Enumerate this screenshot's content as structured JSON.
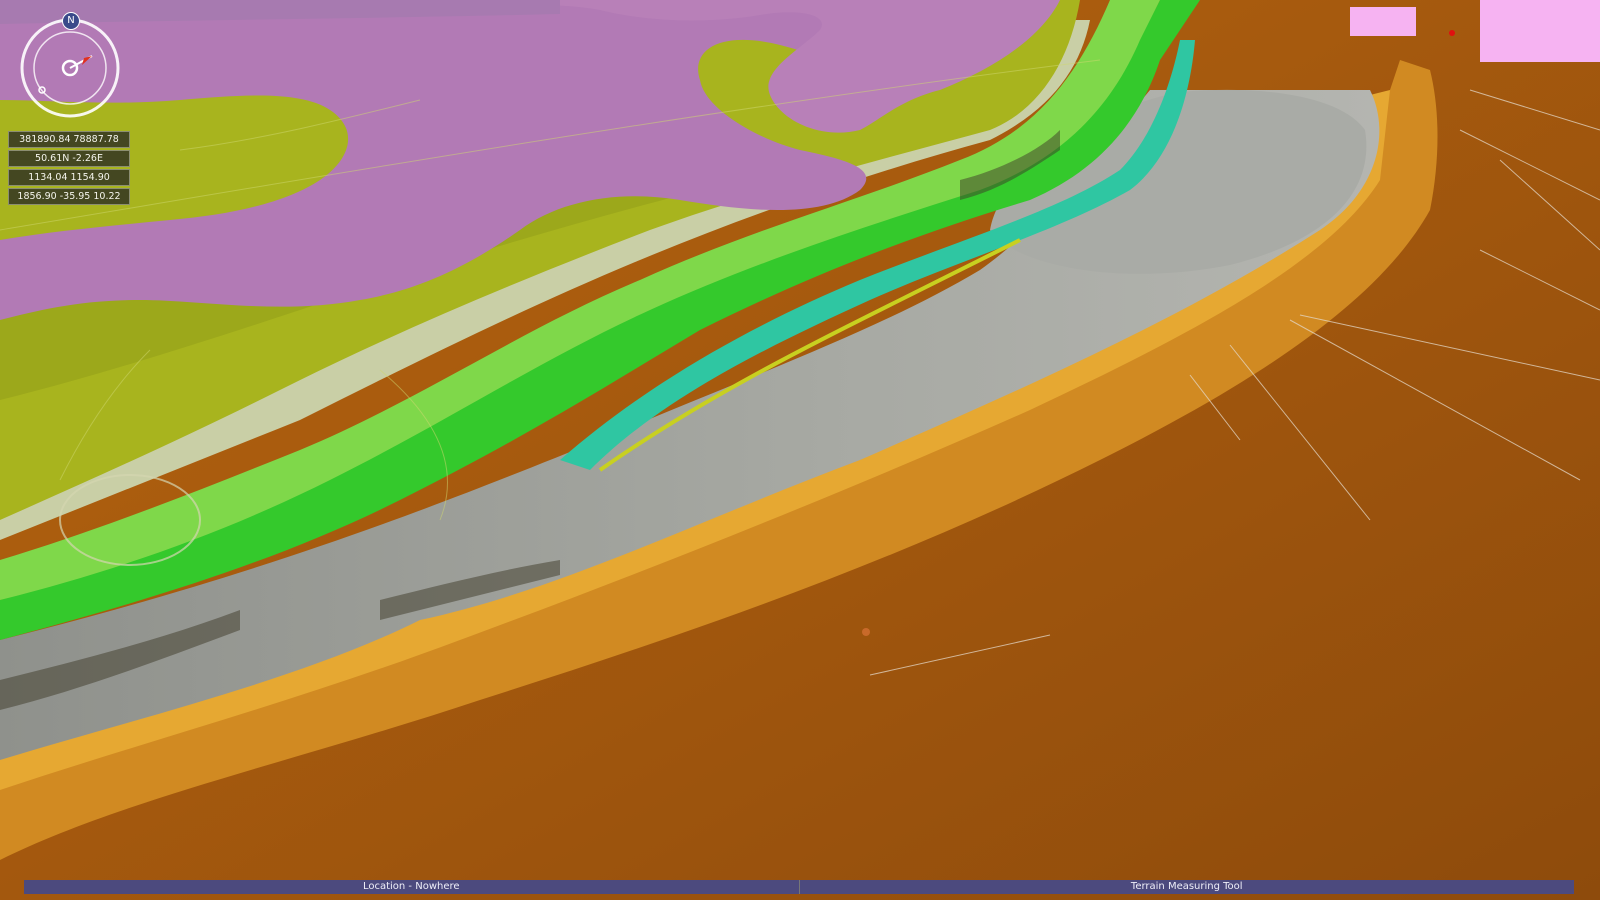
{
  "compass": {
    "north_label": "N",
    "icon": "compass-icon"
  },
  "coordinates": {
    "rows": [
      "381890.84 78887.78",
      "50.61N -2.26E",
      "1134.04 1154.90",
      "1856.90 -35.95 10.22"
    ]
  },
  "status_bar": {
    "location": "Location - Nowhere",
    "tool": "Terrain Measuring Tool"
  },
  "colors": {
    "sea_floor": "#9a5410",
    "upland": "#a8b41e",
    "purple_layer": "#b27ab5",
    "green_band": "#2fcc28",
    "teal_band": "#32c8a0",
    "grey_valley": "#9c9e98",
    "orange_band": "#e09a28",
    "status_bar": "#4c4a7e",
    "mini_window": "#f6b3f2"
  }
}
